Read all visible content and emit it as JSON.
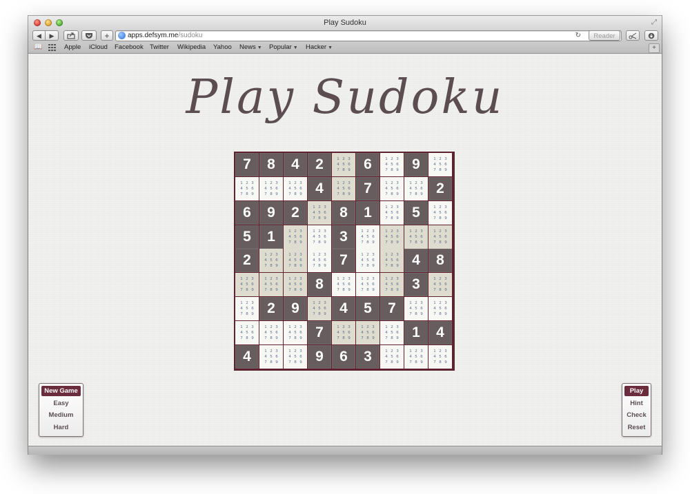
{
  "window": {
    "title": "Play Sudoku"
  },
  "toolbar": {
    "back": "◀",
    "forward": "▶",
    "new_tab": "+",
    "url_host": "apps.defsym.me",
    "url_path": "/sudoku",
    "reader_label": "Reader"
  },
  "bookmarks": [
    {
      "label": "Apple"
    },
    {
      "label": "iCloud"
    },
    {
      "label": "Facebook"
    },
    {
      "label": "Twitter"
    },
    {
      "label": "Wikipedia"
    },
    {
      "label": "Yahoo"
    },
    {
      "label": "News",
      "menu": true
    },
    {
      "label": "Popular",
      "menu": true
    },
    {
      "label": "Hacker",
      "menu": true
    }
  ],
  "page": {
    "title": "Play Sudoku"
  },
  "board": {
    "rows": [
      [
        "7",
        "8",
        "4",
        "2",
        "",
        "6",
        "",
        "9",
        ""
      ],
      [
        "",
        "",
        "",
        "4",
        "",
        "7",
        "",
        "",
        "2"
      ],
      [
        "6",
        "9",
        "2",
        "",
        "8",
        "1",
        "",
        "5",
        ""
      ],
      [
        "5",
        "1",
        "",
        "",
        "3",
        "",
        "",
        "",
        ""
      ],
      [
        "2",
        "",
        "",
        "",
        "7",
        "",
        "",
        "4",
        "8"
      ],
      [
        "",
        "",
        "",
        "8",
        "",
        "",
        "",
        "3",
        ""
      ],
      [
        "",
        "2",
        "9",
        "",
        "4",
        "5",
        "7",
        "",
        ""
      ],
      [
        "",
        "",
        "",
        "7",
        "",
        "",
        "",
        "1",
        "4"
      ],
      [
        "4",
        "",
        "",
        "9",
        "6",
        "3",
        "",
        "",
        ""
      ]
    ],
    "candidates": [
      "1",
      "2",
      "3",
      "4",
      "5",
      "6",
      "7",
      "8",
      "9"
    ]
  },
  "left_menu": [
    {
      "label": "New Game",
      "active": true
    },
    {
      "label": "Easy"
    },
    {
      "label": "Medium"
    },
    {
      "label": "Hard"
    }
  ],
  "right_menu": [
    {
      "label": "Play",
      "active": true
    },
    {
      "label": "Hint"
    },
    {
      "label": "Check"
    },
    {
      "label": "Reset"
    }
  ],
  "colors": {
    "board_border": "#60202e",
    "given_cell": "#675c5e",
    "shade_cell": "#dedbcf",
    "light_cell": "#f7f7f4",
    "accent": "#6b2c3e",
    "candidate_text": "#5d6e8f"
  }
}
